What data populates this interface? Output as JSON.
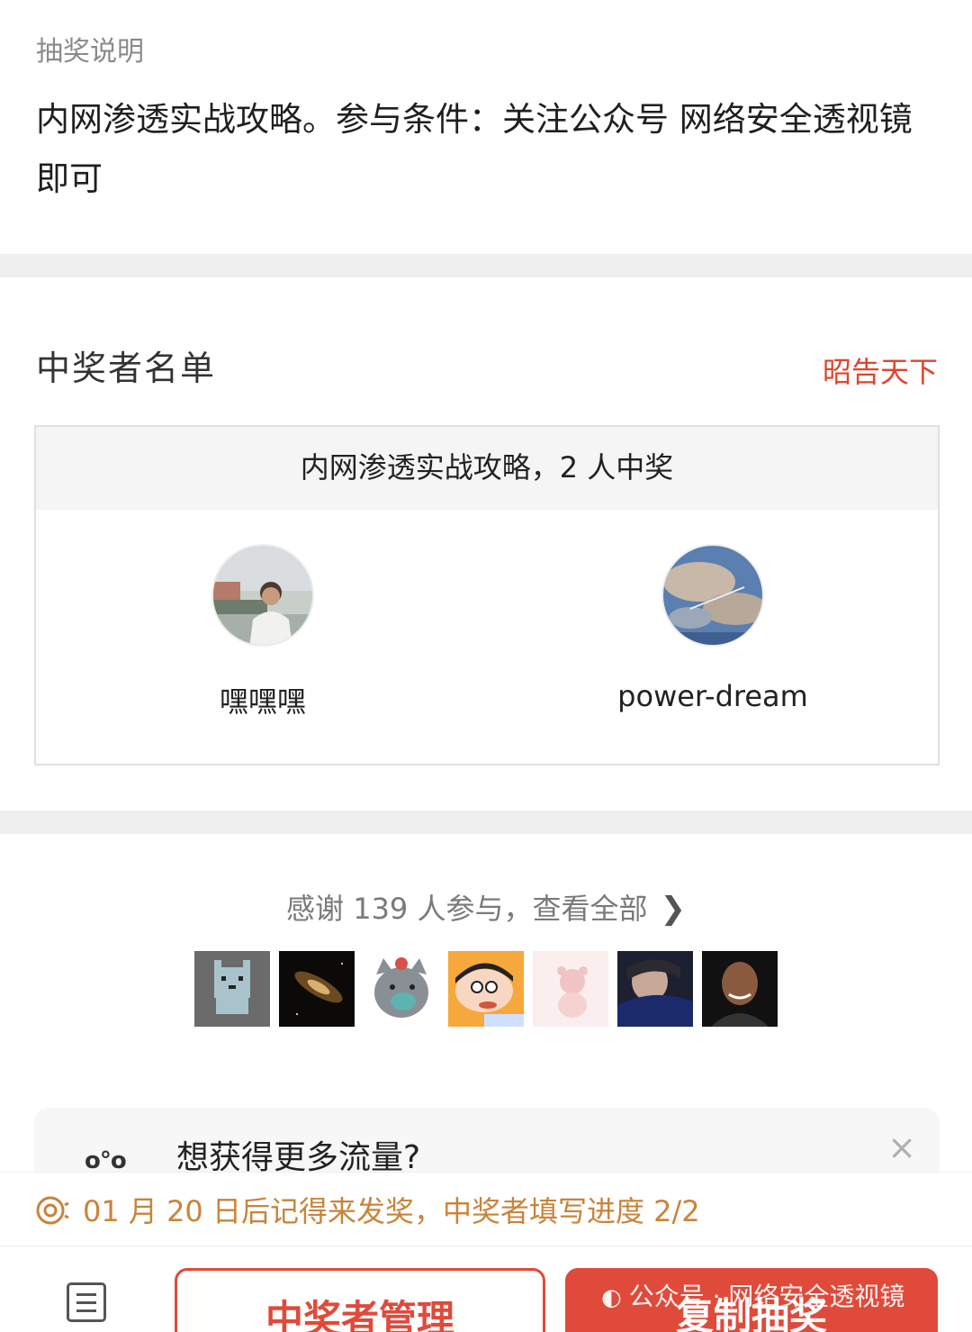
{
  "description": {
    "label": "抽奖说明",
    "text": "内网渗透实战攻略。参与条件：关注公众号 网络安全透视镜 即可"
  },
  "winners": {
    "title": "中奖者名单",
    "announce_link": "昭告天下",
    "box_header": "内网渗透实战攻略，2 人中奖",
    "list": [
      {
        "name": "嘿嘿嘿",
        "avatar": "person-photo-avatar"
      },
      {
        "name": "power-dream",
        "avatar": "sky-clouds-avatar"
      }
    ]
  },
  "participants": {
    "thanks_text": "感谢 139 人参与，查看全部",
    "chevron_icon": "chevron-right-icon",
    "avatars": [
      {
        "icon": "pixel-cat-avatar"
      },
      {
        "icon": "galaxy-avatar"
      },
      {
        "icon": "masked-cat-avatar"
      },
      {
        "icon": "cartoon-boy-avatar"
      },
      {
        "icon": "pink-bear-avatar"
      },
      {
        "icon": "dark-portrait-avatar"
      },
      {
        "icon": "bald-man-avatar"
      }
    ]
  },
  "traffic_card": {
    "icon": "people-dots-icon",
    "icon_text": "o°o",
    "text": "想获得更多流量?",
    "close_icon": "close-icon",
    "close_glyph": "×"
  },
  "notice": {
    "icon": "prize-clock-icon",
    "text": "01 月 20 日后记得来发奖，中奖者填写进度 2/2"
  },
  "bottom_bar": {
    "menu_icon": "list-icon",
    "manage_button": "中奖者管理",
    "copy_button": "复制抽奖"
  },
  "watermark": {
    "text": "公众号 · 网络安全透视镜"
  },
  "colors": {
    "accent": "#e04a3a",
    "notice": "#c8843a",
    "divider": "#efefef"
  }
}
